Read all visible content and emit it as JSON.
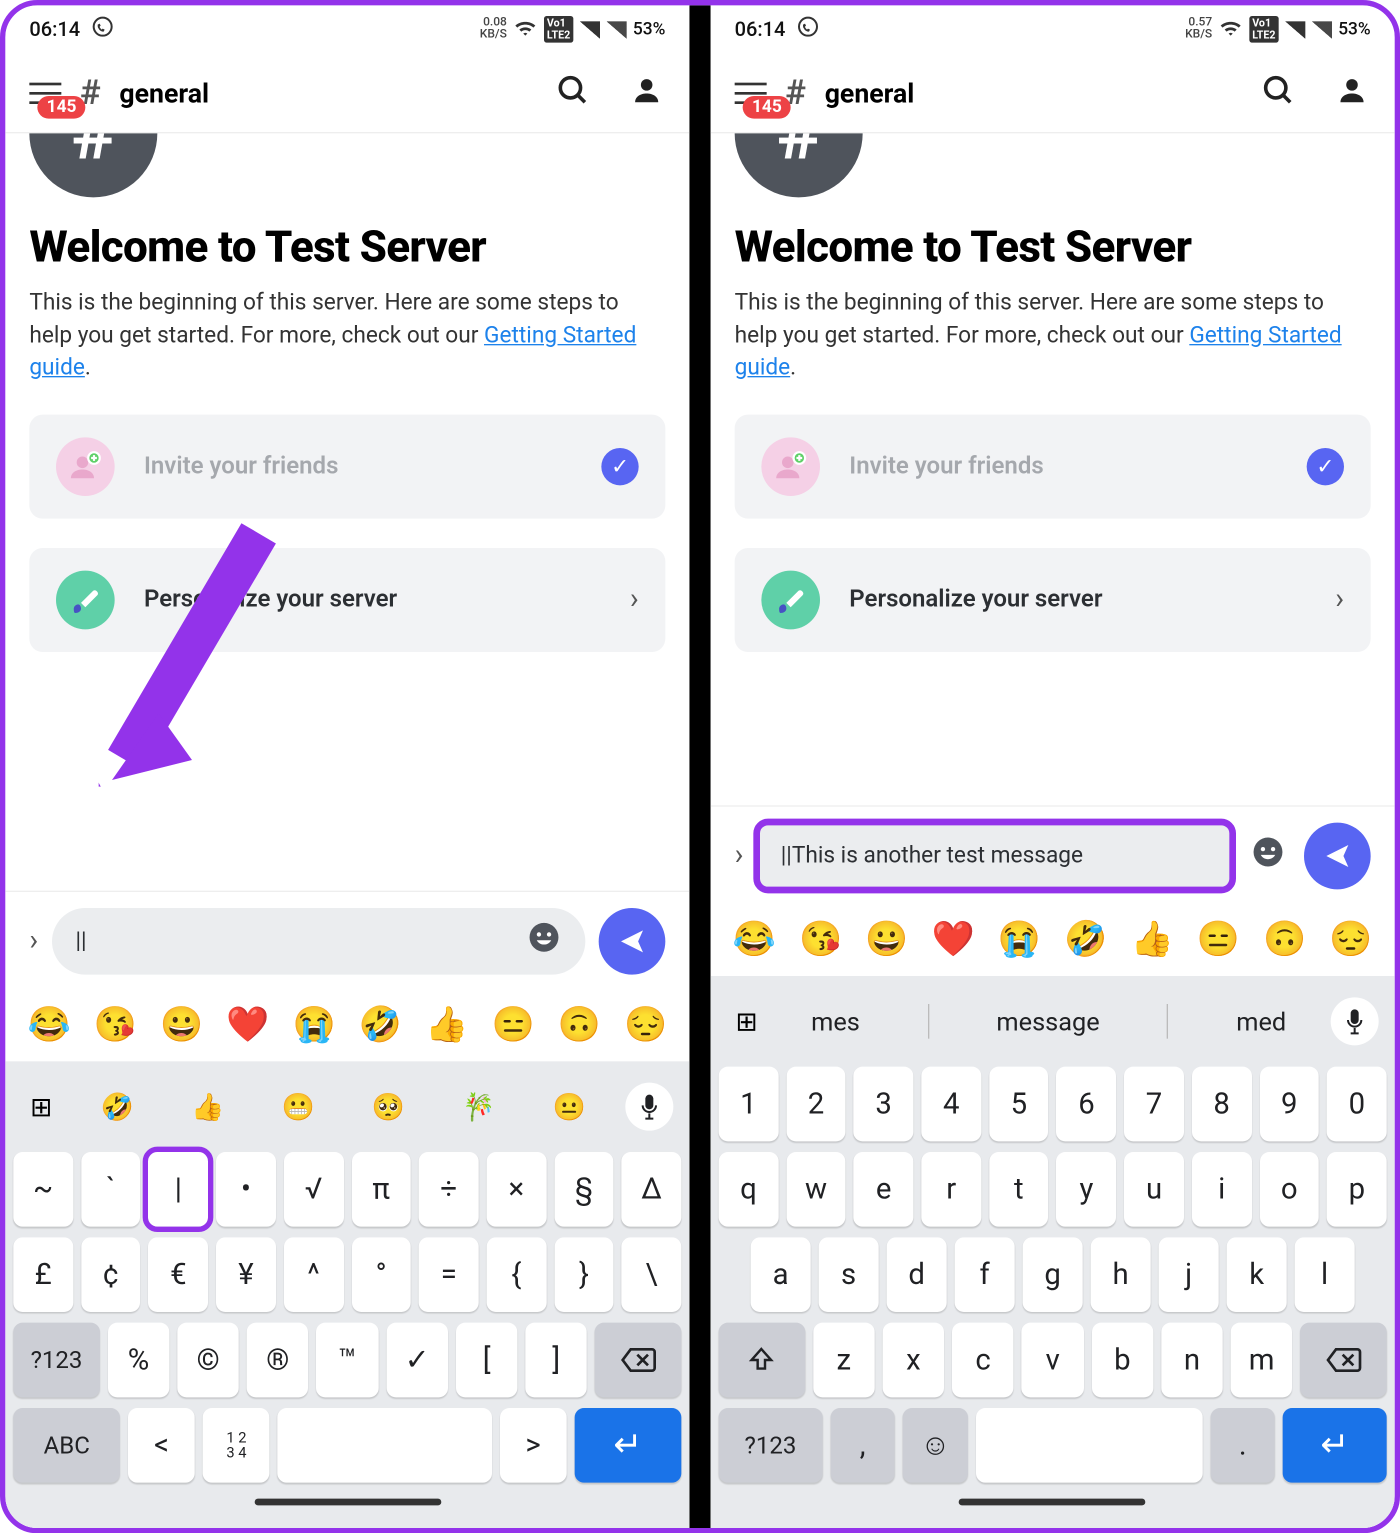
{
  "status": {
    "time": "06:14",
    "kbs_left": "0.08",
    "kbs_right": "0.57",
    "kbs_unit": "KB/S",
    "lte1": "Vo1",
    "lte2": "LTE2",
    "battery": "53%"
  },
  "header": {
    "badge": "145",
    "channel": "general"
  },
  "welcome": {
    "title": "Welcome to Test Server",
    "desc_pre": "This is the beginning of this server. Here are some steps to help you get started. For more, check out our ",
    "link": "Getting Started guide",
    "desc_post": "."
  },
  "cards": {
    "invite": "Invite your friends",
    "personalize": "Personalize your server"
  },
  "input": {
    "left_text": "||",
    "right_text": "||This is another test message"
  },
  "emoji_strip": [
    "😂",
    "😘",
    "😀",
    "❤️",
    "😭",
    "🤣",
    "👍",
    "😑",
    "🙃",
    "😔"
  ],
  "suggestions_left": [
    "🤣",
    "👍",
    "😬",
    "🥺",
    "🎋",
    "😐"
  ],
  "suggestions_right": [
    "mes",
    "message",
    "med"
  ],
  "keys_sym": {
    "r1": [
      "~",
      "`",
      "|",
      "•",
      "√",
      "π",
      "÷",
      "×",
      "§",
      "Δ"
    ],
    "r2": [
      "£",
      "¢",
      "€",
      "¥",
      "^",
      "°",
      "=",
      "{",
      "}",
      "\\"
    ],
    "r3_left": "?123",
    "r3": [
      "%",
      "©",
      "®",
      "™",
      "✓",
      "[",
      "]"
    ],
    "r4_left": "ABC",
    "r4_a": "<",
    "r4_b_top": "1 2",
    "r4_b_bot": "3 4",
    "r4_c": ">"
  },
  "keys_qwerty": {
    "r1": [
      "1",
      "2",
      "3",
      "4",
      "5",
      "6",
      "7",
      "8",
      "9",
      "0"
    ],
    "r2": [
      "q",
      "w",
      "e",
      "r",
      "t",
      "y",
      "u",
      "i",
      "o",
      "p"
    ],
    "r3": [
      "a",
      "s",
      "d",
      "f",
      "g",
      "h",
      "j",
      "k",
      "l"
    ],
    "r4": [
      "z",
      "x",
      "c",
      "v",
      "b",
      "n",
      "m"
    ],
    "r5_left": "?123",
    "r5_a": ",",
    "r5_b": "."
  }
}
